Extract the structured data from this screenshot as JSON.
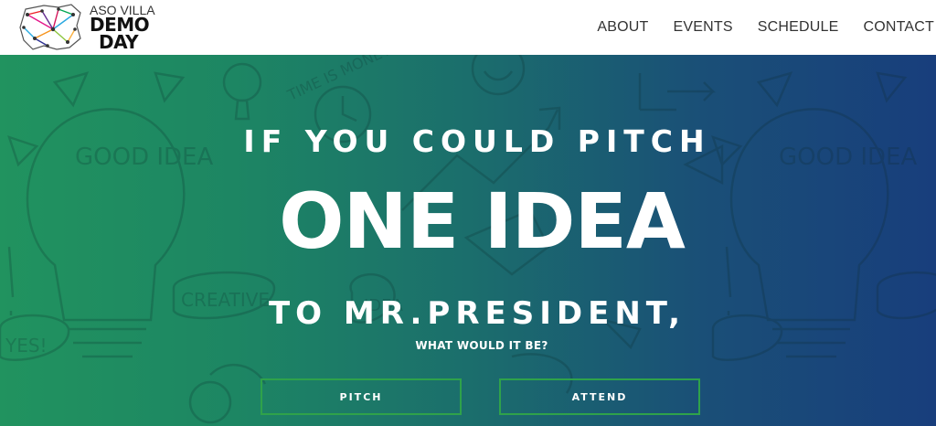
{
  "header": {
    "logo": {
      "line1": "ASO VILLA",
      "line2": "DEMO",
      "line3": "DAY",
      "icon": "nigeria-map-network-icon"
    },
    "nav": [
      {
        "label": "ABOUT"
      },
      {
        "label": "EVENTS"
      },
      {
        "label": "SCHEDULE"
      },
      {
        "label": "CONTACT"
      }
    ]
  },
  "hero": {
    "line1": "IF YOU COULD PITCH",
    "line2": "ONE IDEA",
    "line3": "TO MR.PRESIDENT,",
    "subline": "WHAT WOULD IT BE?",
    "buttons": {
      "pitch": "PITCH",
      "attend": "ATTEND"
    },
    "background_doodle_words": [
      "GOOD IDEA",
      "TIME IS MONEY",
      "CREATIVE",
      "YES!",
      "IDEA",
      "YES"
    ],
    "colors": {
      "gradient_left": "#21935f",
      "gradient_right": "#183e7c",
      "button_border": "#2fa24a"
    }
  }
}
